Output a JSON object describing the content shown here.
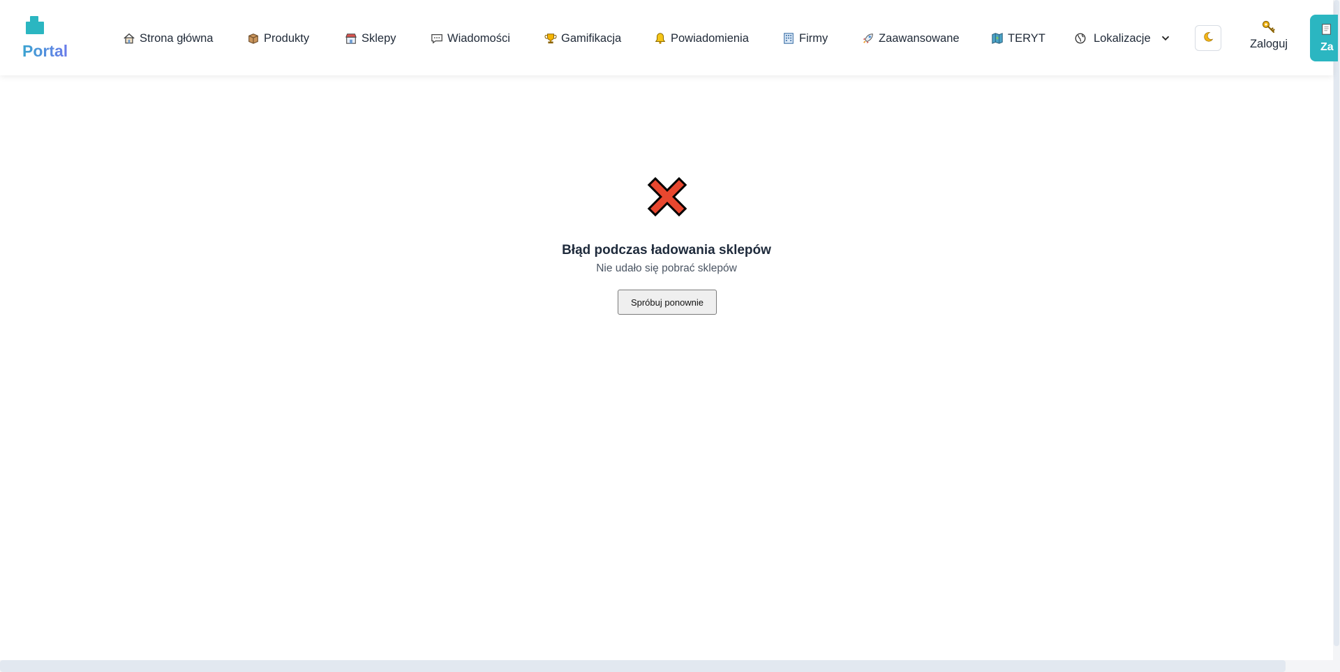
{
  "brand": {
    "name": "Portal"
  },
  "nav": {
    "items": [
      {
        "label": "Strona główna",
        "icon": "house-icon"
      },
      {
        "label": "Produkty",
        "icon": "package-icon"
      },
      {
        "label": "Sklepy",
        "icon": "store-icon"
      },
      {
        "label": "Wiadomości",
        "icon": "speech-bubble-icon"
      },
      {
        "label": "Gamifikacja",
        "icon": "trophy-icon"
      },
      {
        "label": "Powiadomienia",
        "icon": "bell-icon"
      },
      {
        "label": "Firmy",
        "icon": "office-building-icon"
      },
      {
        "label": "Zaawansowane",
        "icon": "rocket-icon"
      },
      {
        "label": "TERYT",
        "icon": "map-icon"
      },
      {
        "label": "Lokalizacje",
        "icon": "globe-icon",
        "dropdown": true
      }
    ],
    "theme_toggle_icon": "moon-icon",
    "login_label": "Zaloguj",
    "register_label": "Za"
  },
  "error": {
    "icon": "cross-mark-icon",
    "title": "Błąd podczas ładowania sklepów",
    "message": "Nie udało się pobrać sklepów",
    "retry_label": "Spróbuj ponownie"
  },
  "colors": {
    "accent": "#2bb6c1",
    "error_red": "#e8472f",
    "text_dark": "#1e2a3b"
  }
}
